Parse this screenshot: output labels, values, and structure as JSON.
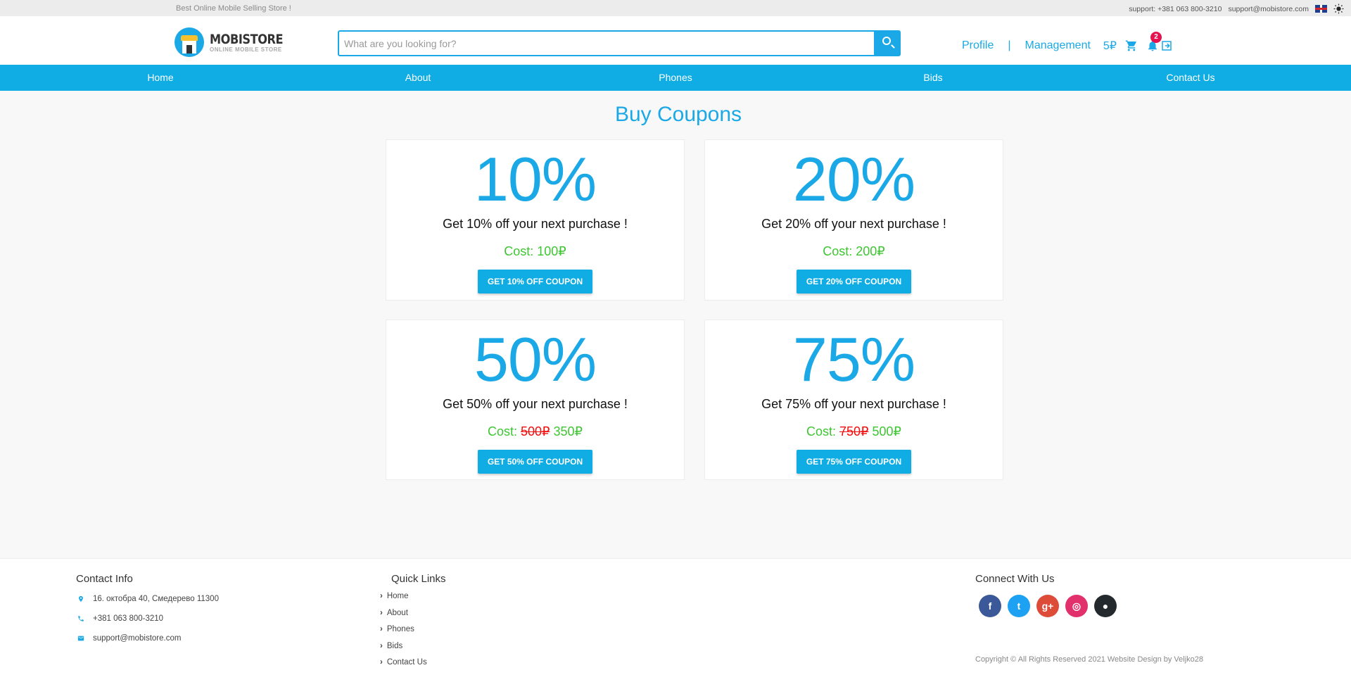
{
  "topbar": {
    "tagline": "Best Online Mobile Selling Store !",
    "support_phone": "support: +381 063 800-3210",
    "support_email": "support@mobistore.com"
  },
  "header": {
    "logo_name": "MOBISTORE",
    "logo_sub": "ONLINE MOBILE STORE",
    "search_placeholder": "What are you looking for?",
    "profile": "Profile",
    "separator": "|",
    "management": "Management",
    "balance": "5₽",
    "notification_count": "2"
  },
  "navbar": [
    "Home",
    "About",
    "Phones",
    "Bids",
    "Contact Us"
  ],
  "main": {
    "title": "Buy Coupons",
    "coupons": [
      {
        "percent": "10%",
        "desc": "Get 10% off your next purchase !",
        "cost_label": "Cost:",
        "old_price": "",
        "price": "100₽",
        "button": "GET 10% OFF COUPON"
      },
      {
        "percent": "20%",
        "desc": "Get 20% off your next purchase !",
        "cost_label": "Cost:",
        "old_price": "",
        "price": "200₽",
        "button": "GET 20% OFF COUPON"
      },
      {
        "percent": "50%",
        "desc": "Get 50% off your next purchase !",
        "cost_label": "Cost:",
        "old_price": "500₽",
        "price": "350₽",
        "button": "GET 50% OFF COUPON"
      },
      {
        "percent": "75%",
        "desc": "Get 75% off your next purchase !",
        "cost_label": "Cost:",
        "old_price": "750₽",
        "price": "500₽",
        "button": "GET 75% OFF COUPON"
      }
    ]
  },
  "footer": {
    "contact_title": "Contact Info",
    "address": "16. октобра 40, Смедерево 11300",
    "phone": "+381 063 800-3210",
    "email": "support@mobistore.com",
    "links_title": "Quick Links",
    "links": [
      "Home",
      "About",
      "Phones",
      "Bids",
      "Contact Us"
    ],
    "connect_title": "Connect With Us",
    "socials": [
      {
        "name": "facebook-icon",
        "glyph": "f",
        "color": "#3b5998"
      },
      {
        "name": "twitter-icon",
        "glyph": "t",
        "color": "#1da1f2"
      },
      {
        "name": "google-plus-icon",
        "glyph": "g+",
        "color": "#dd4b39"
      },
      {
        "name": "instagram-icon",
        "glyph": "◎",
        "color": "#e1306c"
      },
      {
        "name": "github-icon",
        "glyph": "●",
        "color": "#24292e"
      }
    ],
    "copyright": "Copyright © All Rights Reserved 2021 Website Design by Veljko28"
  }
}
